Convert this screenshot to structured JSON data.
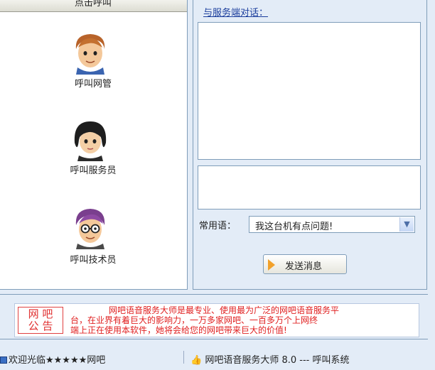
{
  "left": {
    "header": "点击呼叫",
    "items": [
      {
        "label": "呼叫网管",
        "icon": "cartoon-man-avatar"
      },
      {
        "label": "呼叫服务员",
        "icon": "cartoon-woman-avatar"
      },
      {
        "label": "呼叫技术员",
        "icon": "cartoon-glasses-avatar"
      }
    ]
  },
  "right": {
    "dialog_title": "与服务端对话：",
    "phrase_label": "常用语：",
    "phrase_value": "我这台机有点问题!",
    "send_label": "发送消息"
  },
  "notice": {
    "badge_top": "网 吧",
    "badge_bottom": "公 告",
    "line1": "网吧语音服务大师是最专业、使用最为广泛的网吧语音服务平",
    "line2": "台，在业界有着巨大的影响力，一万多家网吧、一百多万个上网终",
    "line3": "端上正在使用本软件，她将会给您的网吧带来巨大的价值!"
  },
  "status": {
    "left": "欢迎光临★★★★★网吧",
    "right": "网吧语音服务大师 8.0 --- 呼叫系统"
  },
  "colors": {
    "panel_bg": "#e3ecf7",
    "border": "#7f9db9",
    "link": "#1a3d9c",
    "notice_red": "#e02020"
  }
}
